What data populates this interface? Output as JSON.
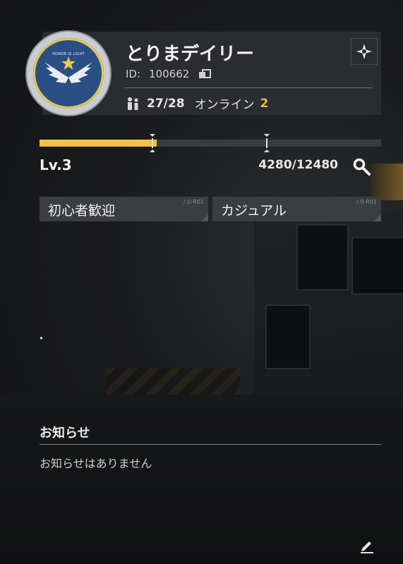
{
  "guild": {
    "name": "とりまデイリー",
    "id_label": "ID:",
    "id_value": "100662",
    "members": "27/28",
    "online_label": "オンライン",
    "online_count": "2",
    "emblem_motto": "HONOR IS LIGHT"
  },
  "progress": {
    "level": "Lv.3",
    "xp_text": "4280/12480",
    "xp_fraction": 0.343
  },
  "tags": [
    {
      "label": "初心者歓迎",
      "code": "/.0-R01"
    },
    {
      "label": "カジュアル",
      "code": "/.0-R01"
    }
  ],
  "notice": {
    "title": "お知らせ",
    "empty_text": "お知らせはありません"
  },
  "colors": {
    "accent": "#f1c24a",
    "online": "#f0b739",
    "panel": "#2c2e31",
    "emblem_blue": "#2a4f86"
  },
  "icons": {
    "settings": "crosshair-icon",
    "copy": "copy-icon",
    "members": "members-icon",
    "search": "search-icon",
    "edit": "pencil-icon"
  }
}
